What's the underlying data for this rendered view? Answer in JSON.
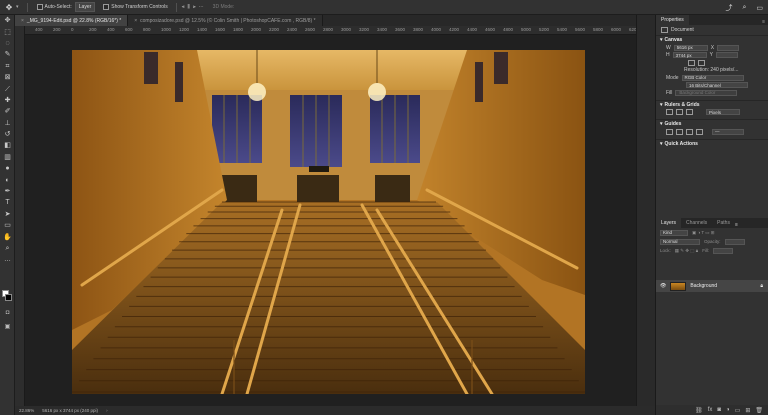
{
  "options_bar": {
    "tool_icon": "move-tool-icon",
    "auto_select_label": "Auto-Select:",
    "auto_select_target": "Layer",
    "transform_controls_label": "Show Transform Controls",
    "mode_3d_label": "3D Mode:",
    "right_icons": [
      "share-icon",
      "search-icon",
      "workspace-icon"
    ],
    "share_label": "Share"
  },
  "tabs": [
    {
      "label": "_MG_9194-Edit.psd @ 22.8% (RGB/16*) *",
      "active": true
    },
    {
      "label": "composizadore.psd @ 12.5% (© Colin Smith | PhotoshopCAFE.com , RGB/8) *",
      "active": false
    }
  ],
  "ruler_ticks": [
    "400",
    "200",
    "0",
    "200",
    "400",
    "600",
    "800",
    "1000",
    "1200",
    "1400",
    "1600",
    "1800",
    "2000",
    "2200",
    "2400",
    "2600",
    "2800",
    "3000",
    "3200",
    "3400",
    "3600",
    "3800",
    "4000",
    "4200",
    "4400",
    "4600",
    "4800",
    "5000",
    "5200",
    "5400",
    "5600",
    "5800",
    "6000",
    "6200"
  ],
  "status": {
    "zoom": "22.86%",
    "doc_info": "5616 px x 3744 px (240 ppi)"
  },
  "properties": {
    "tabs": [
      "Properties"
    ],
    "document_label": "Document",
    "canvas_section": "Canvas",
    "width_label": "W",
    "width_value": "5616 px",
    "height_label": "H",
    "height_value": "3744 px",
    "x_label": "X",
    "y_label": "Y",
    "resolution": "Resolution: 240 pixels/...",
    "mode_label": "Mode",
    "mode_value": "RGB Color",
    "depth_value": "16 Bits/Channel",
    "fill_label": "Fill",
    "fill_value": "Background Color",
    "rulers_section": "Rulers & Grids",
    "units_value": "Pixels",
    "guides_section": "Guides",
    "quick_actions_section": "Quick Actions"
  },
  "layers": {
    "tabs": [
      "Layers",
      "Channels",
      "Paths"
    ],
    "kind_label": "Kind",
    "blend_mode": "Normal",
    "opacity_label": "Opacity:",
    "lock_label": "Lock:",
    "fill_label": "Fill:",
    "items": [
      {
        "name": "Background",
        "visible": true,
        "locked": true
      }
    ]
  },
  "toolbar": {
    "tools": [
      "move",
      "artboard",
      "marquee",
      "lasso",
      "quick-select",
      "crop",
      "frame",
      "eyedropper",
      "spot-heal",
      "brush",
      "clone-stamp",
      "history-brush",
      "eraser",
      "gradient",
      "blur",
      "dodge",
      "pen",
      "type",
      "path-select",
      "rectangle",
      "hand",
      "zoom",
      "more"
    ],
    "foreground": "#ffffff",
    "background": "#000000"
  }
}
